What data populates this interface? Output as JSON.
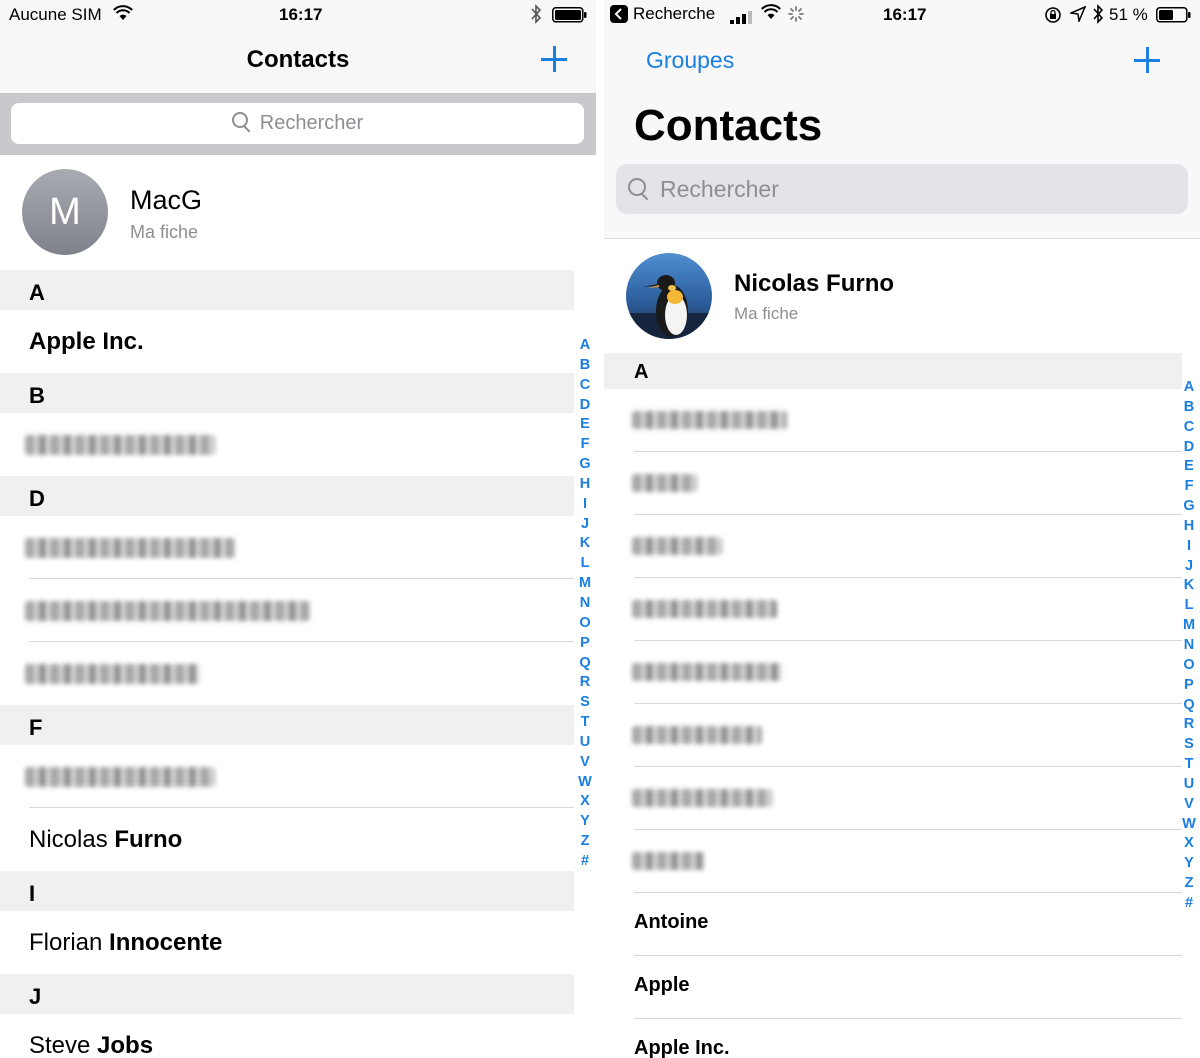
{
  "left": {
    "status": {
      "carrier": "Aucune SIM",
      "time": "16:17"
    },
    "nav": {
      "title": "Contacts"
    },
    "search": {
      "placeholder": "Rechercher"
    },
    "me": {
      "initial": "M",
      "name": "MacG",
      "subtitle": "Ma fiche"
    },
    "sections": [
      {
        "letter": "A",
        "rows": [
          {
            "first": "",
            "last": "Apple Inc."
          }
        ]
      },
      {
        "letter": "B",
        "rows": [
          {
            "blurred": true
          }
        ]
      },
      {
        "letter": "D",
        "rows": [
          {
            "blurred": true
          },
          {
            "blurred": true
          },
          {
            "blurred": true
          }
        ]
      },
      {
        "letter": "F",
        "rows": [
          {
            "blurred": true
          },
          {
            "first": "Nicolas",
            "last": "Furno"
          }
        ]
      },
      {
        "letter": "I",
        "rows": [
          {
            "first": "Florian",
            "last": "Innocente"
          }
        ]
      },
      {
        "letter": "J",
        "rows": [
          {
            "first": "Steve",
            "last": "Jobs"
          }
        ]
      }
    ]
  },
  "right": {
    "status": {
      "back_app": "Recherche",
      "time": "16:17",
      "battery": "51 %"
    },
    "nav": {
      "groups": "Groupes",
      "title": "Contacts"
    },
    "search": {
      "placeholder": "Rechercher"
    },
    "me": {
      "name": "Nicolas Furno",
      "subtitle": "Ma fiche"
    },
    "sections": [
      {
        "letter": "A",
        "rows": [
          {
            "blurred": true
          },
          {
            "blurred": true
          },
          {
            "blurred": true
          },
          {
            "blurred": true
          },
          {
            "blurred": true
          },
          {
            "blurred": true
          },
          {
            "blurred": true
          },
          {
            "blurred": true
          },
          {
            "first": "",
            "last": "Antoine"
          },
          {
            "first": "",
            "last": "Apple"
          },
          {
            "first": "",
            "last": "Apple Inc."
          }
        ]
      }
    ]
  },
  "index_letters": [
    "A",
    "B",
    "C",
    "D",
    "E",
    "F",
    "G",
    "H",
    "I",
    "J",
    "K",
    "L",
    "M",
    "N",
    "O",
    "P",
    "Q",
    "R",
    "S",
    "T",
    "U",
    "V",
    "W",
    "X",
    "Y",
    "Z",
    "#"
  ],
  "colors": {
    "accent": "#1a7fe0",
    "section_bg": "#f0f0f2",
    "secondary_text": "#8e8e93"
  }
}
